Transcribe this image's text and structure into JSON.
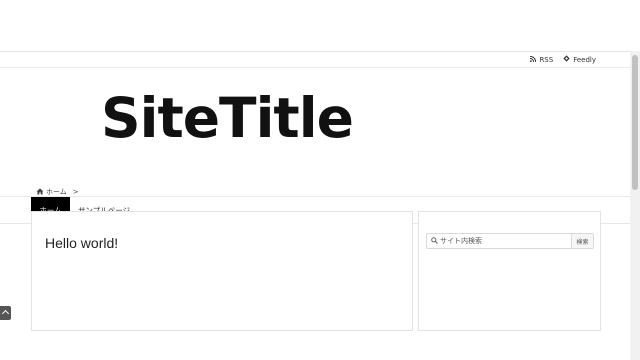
{
  "util_bar": {
    "rss_label": "RSS",
    "rss_icon": "rss-icon",
    "feedly_label": "Feedly",
    "feedly_icon": "feedly-icon"
  },
  "header": {
    "site_title": "SiteTitle"
  },
  "nav": {
    "items": [
      {
        "label": "ホーム",
        "active": true
      },
      {
        "label": "サンプルページ",
        "active": false
      }
    ]
  },
  "breadcrumb": {
    "home_icon": "home-icon",
    "home_label": "ホーム",
    "separator": ">"
  },
  "article": {
    "title": "Hello world!"
  },
  "sidebar": {
    "search": {
      "placeholder": "サイト内検索",
      "button_label": "検索",
      "icon": "search-icon"
    }
  },
  "colors": {
    "nav_active_bg": "#000000",
    "border": "#e3e3e3"
  }
}
